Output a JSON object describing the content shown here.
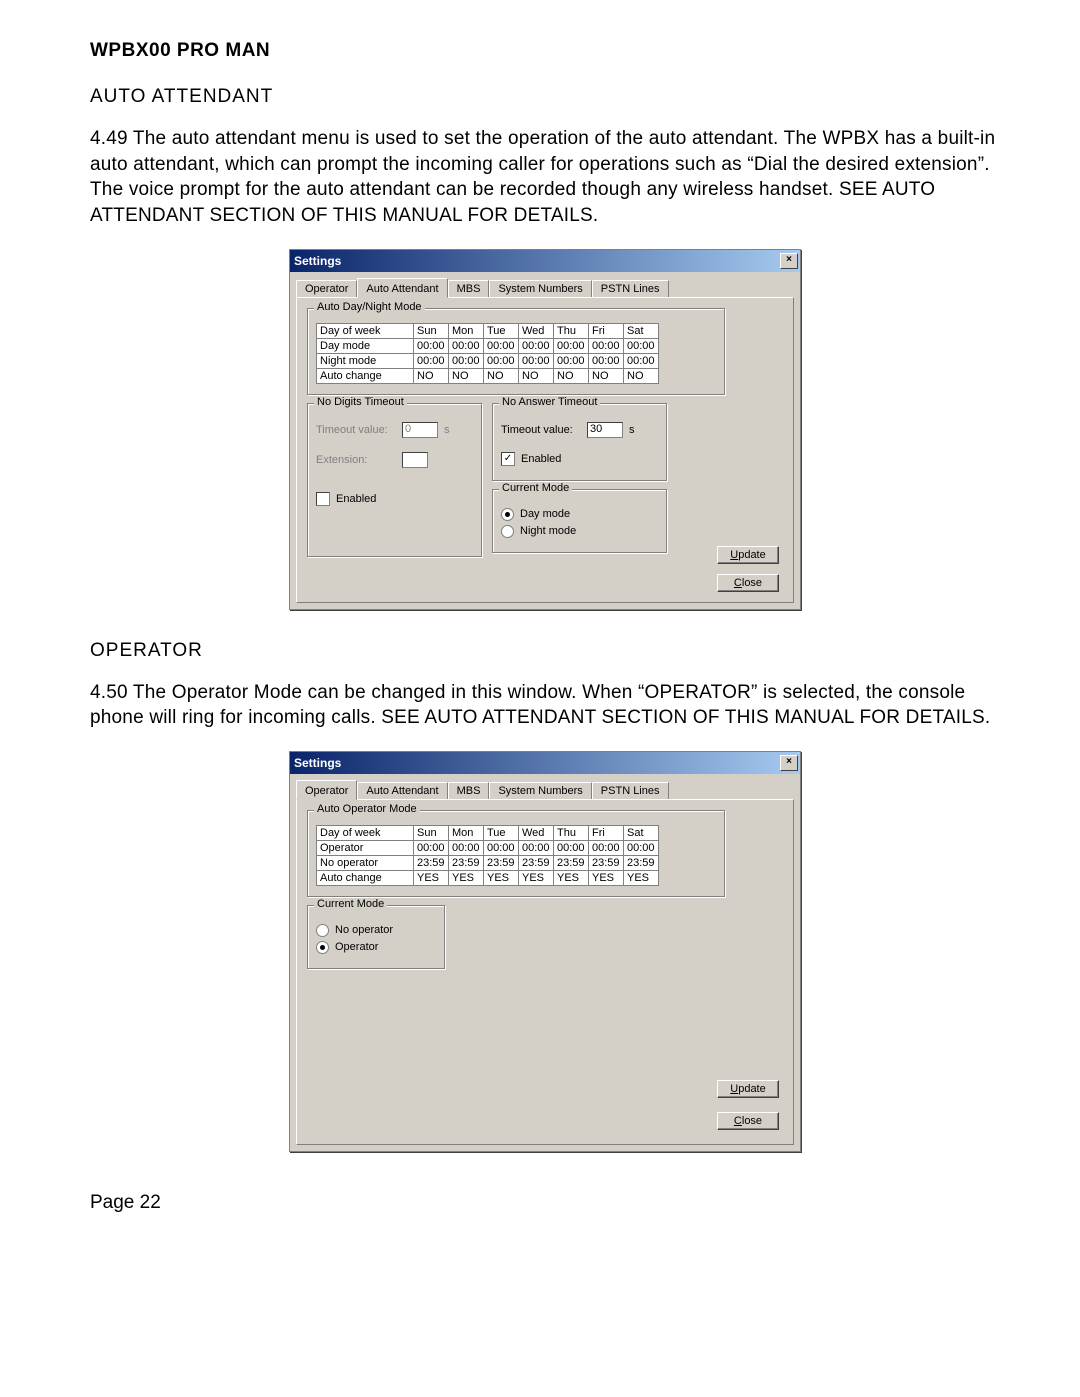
{
  "doc": {
    "title": "WPBX00 PRO MAN",
    "page_number": "Page 22"
  },
  "section1": {
    "heading": "AUTO ATTENDANT",
    "para": "4.49    The auto attendant menu is used to set the operation of the auto attendant.  The WPBX has a built-in auto attendant, which can prompt the incoming caller for operations such as “Dial the desired extension”.  The voice prompt for the auto attendant can be recorded though any wireless handset.  SEE AUTO ATTENDANT SECTION OF THIS MANUAL FOR DETAILS."
  },
  "section2": {
    "heading": "OPERATOR",
    "para": "4.50    The Operator Mode can be changed in this window.  When “OPERATOR” is selected, the console phone will ring for incoming calls.  SEE AUTO ATTENDANT SECTION OF THIS MANUAL FOR DETAILS."
  },
  "window": {
    "title": "Settings",
    "close_glyph": "×",
    "tabs": {
      "operator": "Operator",
      "auto_attendant": "Auto Attendant",
      "mbs": "MBS",
      "system_numbers": "System Numbers",
      "pstn_lines": "PSTN Lines"
    },
    "buttons": {
      "update": "Update",
      "close": "Close"
    }
  },
  "auto_attendant_panel": {
    "group_schedule": {
      "title": "Auto Day/Night Mode",
      "rows": {
        "dow": "Day of week",
        "day": "Day mode",
        "night": "Night mode",
        "auto": "Auto change"
      },
      "days": [
        "Sun",
        "Mon",
        "Tue",
        "Wed",
        "Thu",
        "Fri",
        "Sat"
      ],
      "day_vals": [
        "00:00",
        "00:00",
        "00:00",
        "00:00",
        "00:00",
        "00:00",
        "00:00"
      ],
      "night_vals": [
        "00:00",
        "00:00",
        "00:00",
        "00:00",
        "00:00",
        "00:00",
        "00:00"
      ],
      "auto_vals": [
        "NO",
        "NO",
        "NO",
        "NO",
        "NO",
        "NO",
        "NO"
      ]
    },
    "no_digits": {
      "title": "No Digits Timeout",
      "timeout_label": "Timeout value:",
      "timeout_value": "0",
      "unit": "s",
      "extension_label": "Extension:",
      "extension_value": "",
      "enabled_label": "Enabled"
    },
    "no_answer": {
      "title": "No Answer Timeout",
      "timeout_label": "Timeout value:",
      "timeout_value": "30",
      "unit": "s",
      "enabled_label": "Enabled"
    },
    "current_mode": {
      "title": "Current Mode",
      "day": "Day mode",
      "night": "Night mode"
    }
  },
  "operator_panel": {
    "group_schedule": {
      "title": "Auto Operator Mode",
      "rows": {
        "dow": "Day of week",
        "op": "Operator",
        "noop": "No operator",
        "auto": "Auto change"
      },
      "days": [
        "Sun",
        "Mon",
        "Tue",
        "Wed",
        "Thu",
        "Fri",
        "Sat"
      ],
      "op_vals": [
        "00:00",
        "00:00",
        "00:00",
        "00:00",
        "00:00",
        "00:00",
        "00:00"
      ],
      "noop_vals": [
        "23:59",
        "23:59",
        "23:59",
        "23:59",
        "23:59",
        "23:59",
        "23:59"
      ],
      "auto_vals": [
        "YES",
        "YES",
        "YES",
        "YES",
        "YES",
        "YES",
        "YES"
      ]
    },
    "current_mode": {
      "title": "Current Mode",
      "no_operator": "No operator",
      "operator": "Operator"
    }
  }
}
